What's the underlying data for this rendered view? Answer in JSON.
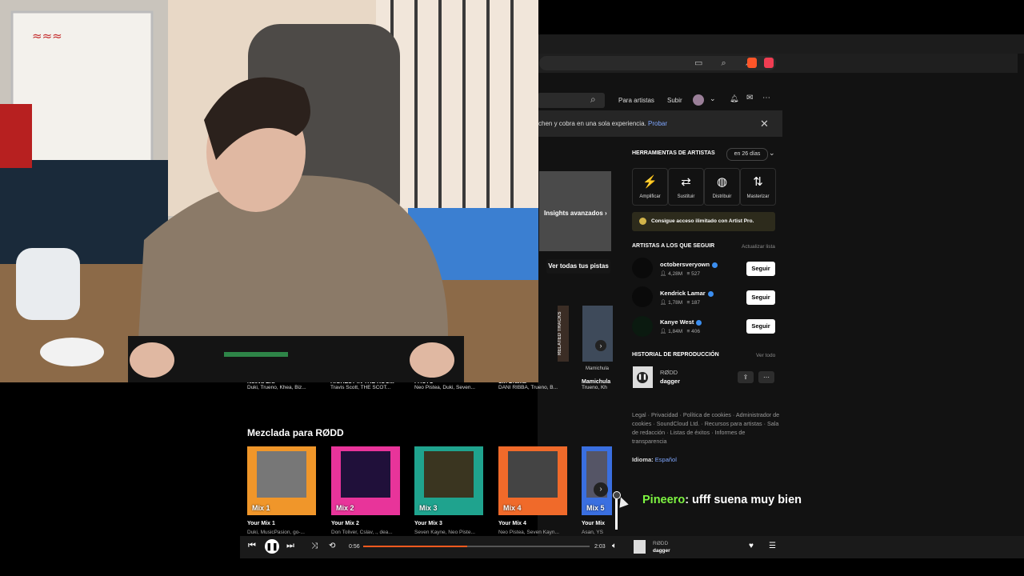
{
  "browser": {
    "toolbar_icons": [
      "cast-icon",
      "zoom-icon",
      "share-icon",
      "brave-shields-icon",
      "brave-rewards-icon"
    ]
  },
  "header": {
    "for_artists": "Para artistas",
    "upload": "Subir"
  },
  "banner": {
    "text": "chen y cobra en una sola experiencia.",
    "link": "Probar"
  },
  "main": {
    "insights": "Insights avanzados",
    "view_all_tracks": "Ver todas tus pistas",
    "related_tracks": "RELATED TRACKS",
    "related_caption": "Mamichula",
    "row_titles": [
      "Nueva Era",
      "HIGHEST IN THE ROOM",
      "PACTO",
      "Sin Drama",
      "Mamichula"
    ],
    "row_subtitles": [
      "Duki, Trueno, Khea, Biz...",
      "Travis Scott, THE SCOT...",
      "Neo Pistea, Duki, Seven...",
      "DANI RIBBA, Trueno, B...",
      "Trueno, Kh"
    ],
    "mix_section_title": "Mezclada para RØDD",
    "mixes": [
      {
        "label": "Mix 1",
        "title": "Your Mix 1",
        "subtitle": "Duki, MusicPasion, go-...",
        "color": "#f0962a"
      },
      {
        "label": "Mix 2",
        "title": "Your Mix 2",
        "subtitle": "Don Toliver, Cslav, ., dea...",
        "color": "#e8349a"
      },
      {
        "label": "Mix 3",
        "title": "Your Mix 3",
        "subtitle": "Seven Kayne, Neo Piste...",
        "color": "#1fa38e"
      },
      {
        "label": "Mix 4",
        "title": "Your Mix 4",
        "subtitle": "Neo Pistea, Seven Kayn...",
        "color": "#f06a2a"
      },
      {
        "label": "Mix 5",
        "title": "Your Mix",
        "subtitle": "Asan, YS",
        "color": "#3a6fe0"
      }
    ]
  },
  "sidebar": {
    "artist_tools_title": "HERRAMIENTAS DE ARTISTAS",
    "trial_pill": "en 26 días",
    "tools": [
      {
        "label": "Amplificar",
        "icon": "amplify-icon"
      },
      {
        "label": "Sustituir",
        "icon": "replace-icon"
      },
      {
        "label": "Distribuir",
        "icon": "distribute-icon"
      },
      {
        "label": "Masterizar",
        "icon": "master-icon"
      }
    ],
    "pro_text": "Consigue acceso ilimitado con Artist Pro.",
    "follow_title": "ARTISTAS A LOS QUE SEGUIR",
    "refresh_list": "Actualizar lista",
    "artists": [
      {
        "name": "octobersveryown",
        "followers": "4,28M",
        "tracks": "527",
        "follow": "Seguir"
      },
      {
        "name": "Kendrick Lamar",
        "followers": "1,78M",
        "tracks": "187",
        "follow": "Seguir"
      },
      {
        "name": "Kanye West",
        "followers": "1,84M",
        "tracks": "406",
        "follow": "Seguir"
      }
    ],
    "history_title": "HISTORIAL DE REPRODUCCIÓN",
    "view_all": "Ver todo",
    "history_item": {
      "artist": "RØDD",
      "track": "dagger"
    },
    "footer_links": "Legal · Privacidad · Política de cookies · Administrador de cookies · SoundCloud Ltd. · Recursos para artistas · Sala de redacción · Listas de éxitos · Informes de transparencia",
    "language_label": "Idioma:",
    "language_value": "Español"
  },
  "chat": {
    "user": "Pineero",
    "message": ": ufff suena muy bien"
  },
  "player": {
    "elapsed": "0:56",
    "duration": "2:03",
    "progress": 0.46,
    "artist": "RØDD",
    "track": "dagger"
  },
  "colors": {
    "accent": "#ff5a1f",
    "link": "#7fa7ff",
    "chat_user": "#7ef542"
  }
}
